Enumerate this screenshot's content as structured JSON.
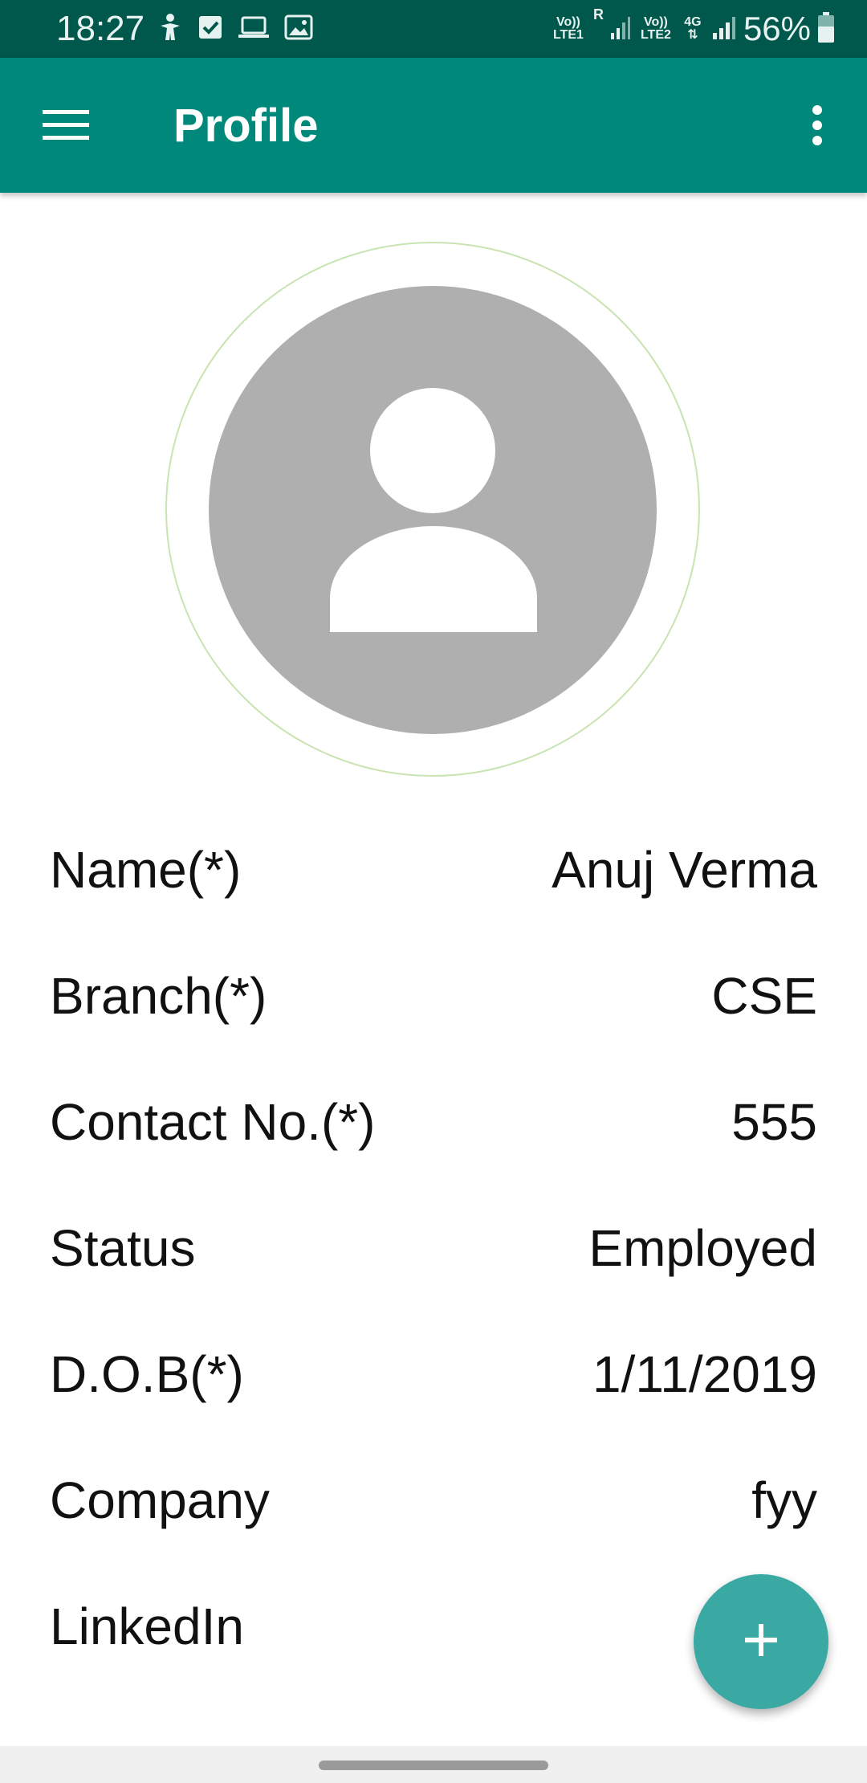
{
  "status_bar": {
    "time": "18:27",
    "left_icons": [
      "accessibility-icon",
      "checkbox-icon",
      "laptop-icon",
      "image-icon"
    ],
    "sim1_label": "Vo)) LTE1",
    "sim1_roaming": "R",
    "sim2_label": "Vo)) LTE2",
    "network_type": "4G",
    "battery_percent": "56%"
  },
  "app_bar": {
    "title": "Profile",
    "menu_icon": "hamburger-menu-icon",
    "overflow_icon": "more-vert-icon"
  },
  "avatar": {
    "icon": "person-placeholder-icon"
  },
  "fields": [
    {
      "label": "Name(*)",
      "value": "Anuj Verma"
    },
    {
      "label": "Branch(*)",
      "value": "CSE"
    },
    {
      "label": "Contact No.(*)",
      "value": "555"
    },
    {
      "label": "Status",
      "value": "Employed"
    },
    {
      "label": "D.O.B(*)",
      "value": "1/11/2019"
    },
    {
      "label": "Company",
      "value": "fyy"
    },
    {
      "label": "LinkedIn",
      "value": ""
    }
  ],
  "fab": {
    "icon": "plus-icon"
  },
  "colors": {
    "status_bar": "#00574b",
    "app_bar": "#00897b",
    "fab": "#3aa9a4",
    "avatar_bg": "#afafaf"
  }
}
